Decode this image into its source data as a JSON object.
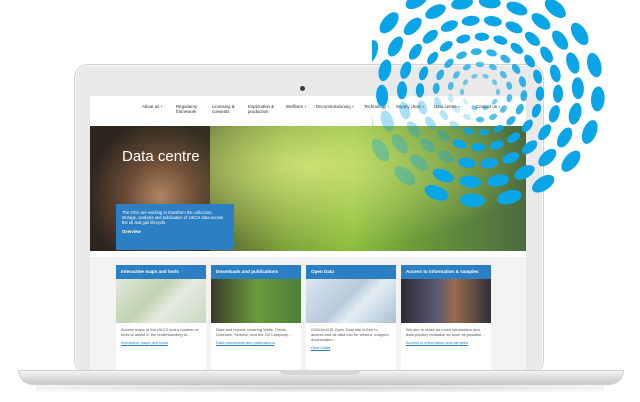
{
  "nav": {
    "items": [
      "About us",
      "Regulatory\nframework",
      "Licensing &\nconsents",
      "Exploration &\nproduction",
      "Wellbore",
      "Decommissioning",
      "Technology",
      "Supply chain",
      "Data centre",
      "Contact us"
    ]
  },
  "hero": {
    "title": "Data centre",
    "intro": "The OGA are working to transform the collection, storage, analysis and publication of UKCS data across the oil and gas lifecycle.",
    "link": "Overview"
  },
  "cards": [
    {
      "title": "Interactive maps and tools",
      "desc": "Access maps of the UKCS and a number of tools to assist in the understanding of...",
      "link": "Interactive maps and tools"
    },
    {
      "title": "Downloads and publications",
      "desc": "Data and reports covering Wells, Fields, Licences, Seismic, and the Oil Campany...",
      "link": "Data downloads and publications"
    },
    {
      "title": "Open Data",
      "desc": "OGA ArcGIS Open Data site is free to access and all data can be viewed, mapped, downloaded...",
      "link": "Open Data"
    },
    {
      "title": "Access to information & samples",
      "desc": "We aim to make as much information and data publicly available as soon as possible...",
      "link": "Access to information and samples"
    }
  ],
  "colors": {
    "accent": "#2c7fc2",
    "logo": "#0aa5e6"
  }
}
